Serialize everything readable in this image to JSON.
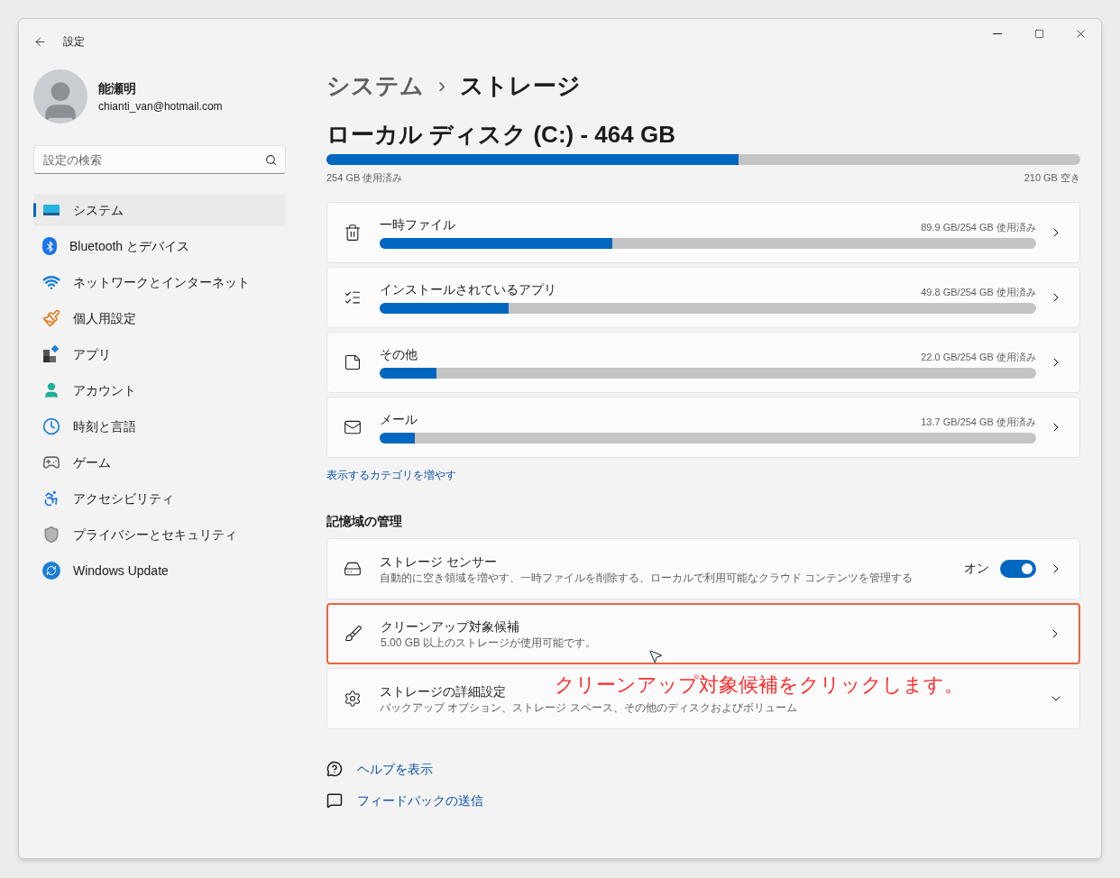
{
  "window": {
    "title": "設定"
  },
  "profile": {
    "name": "能瀬明",
    "email": "chianti_van@hotmail.com"
  },
  "search": {
    "placeholder": "設定の検索"
  },
  "sidebar": {
    "items": [
      {
        "label": "システム",
        "selected": true
      },
      {
        "label": "Bluetooth とデバイス",
        "selected": false
      },
      {
        "label": "ネットワークとインターネット",
        "selected": false
      },
      {
        "label": "個人用設定",
        "selected": false
      },
      {
        "label": "アプリ",
        "selected": false
      },
      {
        "label": "アカウント",
        "selected": false
      },
      {
        "label": "時刻と言語",
        "selected": false
      },
      {
        "label": "ゲーム",
        "selected": false
      },
      {
        "label": "アクセシビリティ",
        "selected": false
      },
      {
        "label": "プライバシーとセキュリティ",
        "selected": false
      },
      {
        "label": "Windows Update",
        "selected": false
      }
    ]
  },
  "breadcrumb": {
    "parent": "システム",
    "separator": "›",
    "current": "ストレージ"
  },
  "disk": {
    "title": "ローカル ディスク (C:) - 464 GB",
    "level": 0.547,
    "used": "254 GB 使用済み",
    "free": "210 GB 空き"
  },
  "categories": [
    {
      "label": "一時ファイル",
      "usage": "89.9 GB/254 GB 使用済み",
      "level": 0.354
    },
    {
      "label": "インストールされているアプリ",
      "usage": "49.8 GB/254 GB 使用済み",
      "level": 0.196
    },
    {
      "label": "その他",
      "usage": "22.0 GB/254 GB 使用済み",
      "level": 0.087
    },
    {
      "label": "メール",
      "usage": "13.7 GB/254 GB 使用済み",
      "level": 0.054
    }
  ],
  "more_link": "表示するカテゴリを増やす",
  "management": {
    "heading": "記憶域の管理",
    "rows": [
      {
        "kind": "toggle",
        "title": "ストレージ センサー",
        "description": "自動的に空き領域を増やす、一時ファイルを削除する、ローカルで利用可能なクラウド コンテンツを管理する",
        "toggle_label": "オン",
        "on": true,
        "highlighted": false
      },
      {
        "kind": "nav",
        "title": "クリーンアップ対象候補",
        "description": "5.00 GB 以上のストレージが使用可能です。",
        "highlighted": true
      },
      {
        "kind": "expand",
        "title": "ストレージの詳細設定",
        "description": "バックアップ オプション、ストレージ スペース、その他のディスクおよびボリューム",
        "highlighted": false,
        "annotation": "クリーンアップ対象候補をクリックします。"
      }
    ]
  },
  "footer_links": [
    {
      "label": "ヘルプを表示"
    },
    {
      "label": "フィードバックの送信"
    }
  ]
}
